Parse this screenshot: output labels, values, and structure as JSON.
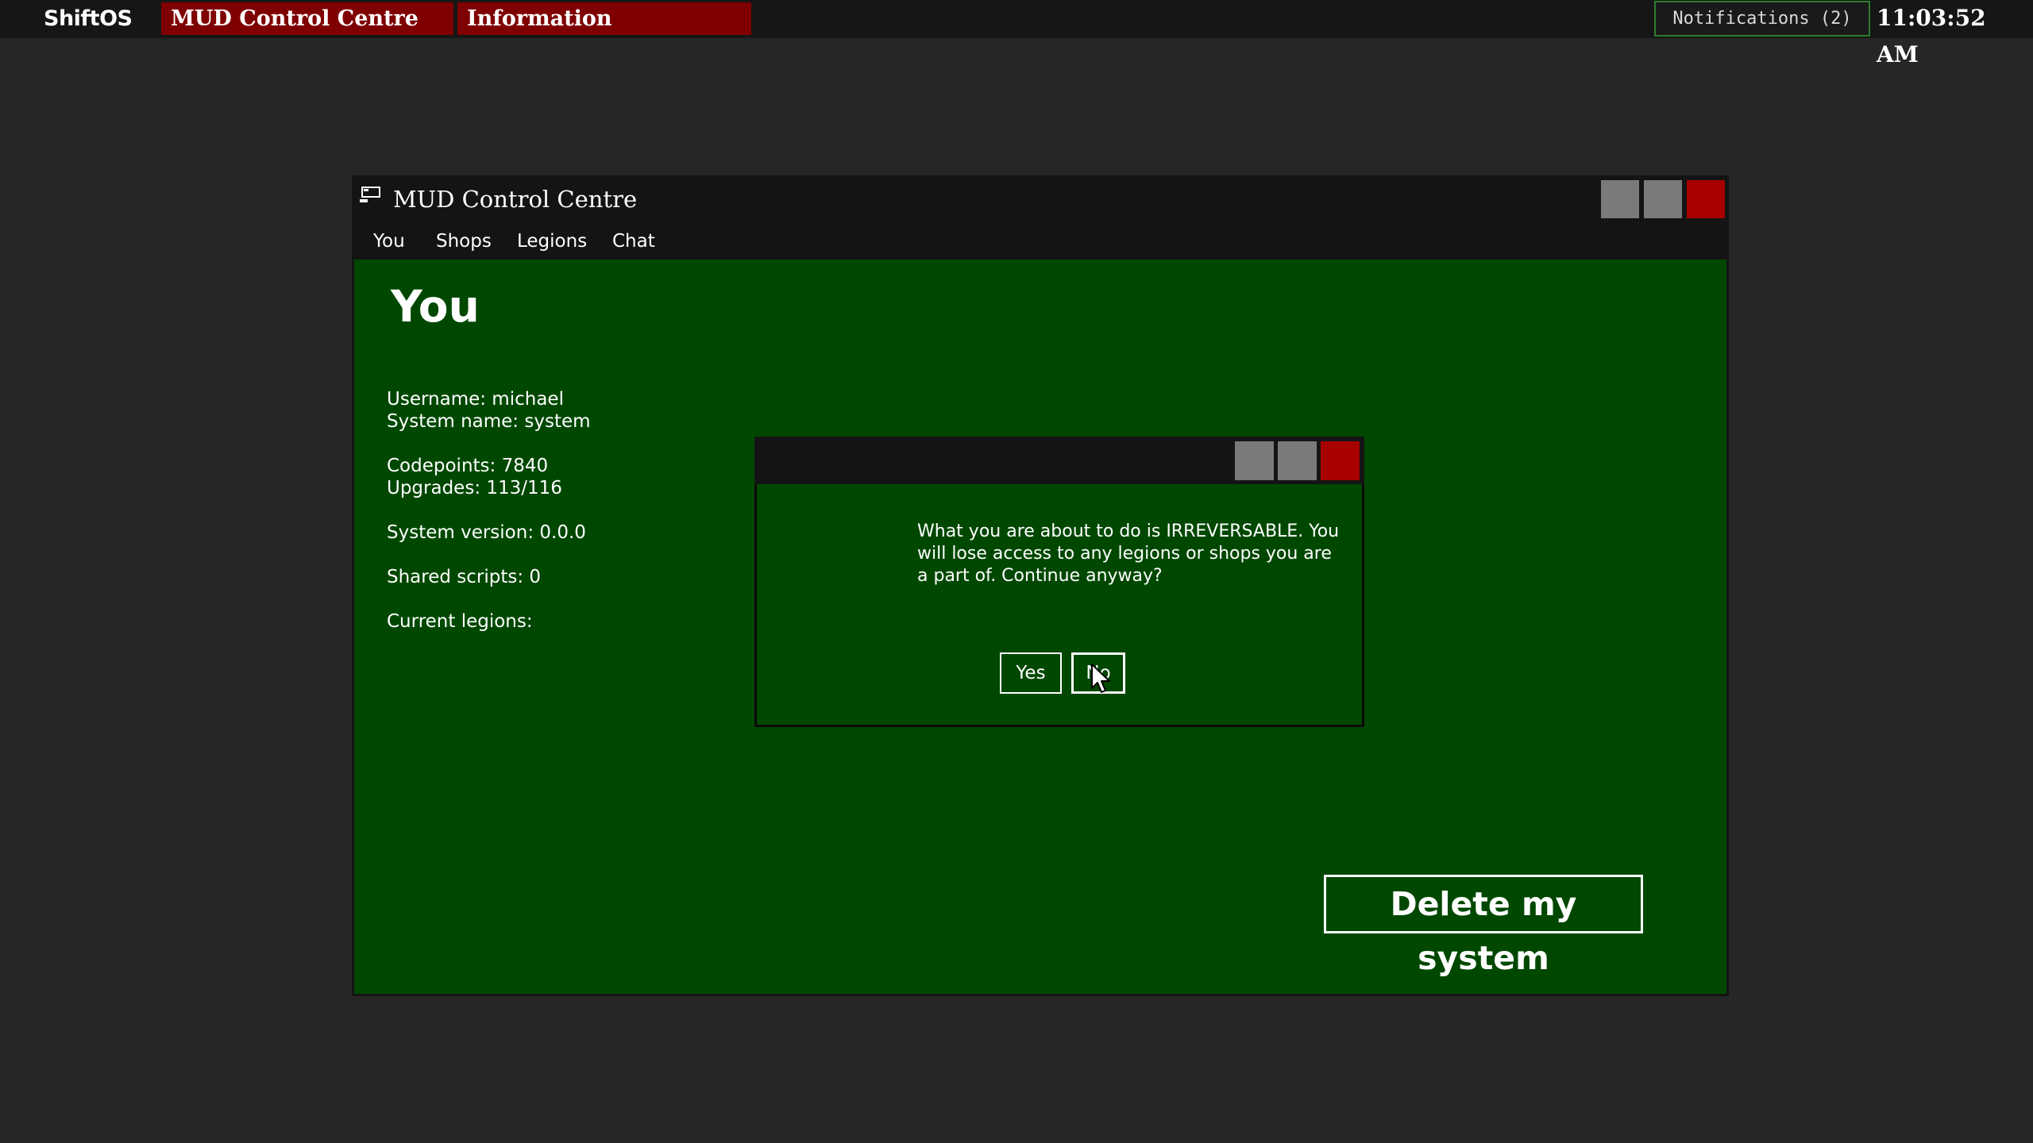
{
  "panel": {
    "start_label": "ShiftOS",
    "tasks": [
      {
        "label": "MUD Control Centre"
      },
      {
        "label": "Information"
      }
    ],
    "notifications_label": "Notifications (2)",
    "clock": "11:03:52 AM"
  },
  "window": {
    "title": "MUD Control Centre",
    "icon": "terminal-window-icon",
    "menu": [
      "You",
      "Shops",
      "Legions",
      "Chat"
    ],
    "heading": "You",
    "info": {
      "username": "Username: michael",
      "system_name": "System name: system",
      "codepoints": "Codepoints: 7840",
      "upgrades": "Upgrades: 113/116",
      "system_version": "System version: 0.0.0",
      "shared_scripts": "Shared scripts: 0",
      "current_legions": "Current legions:"
    },
    "delete_button": "Delete my system"
  },
  "dialog": {
    "title": "",
    "message": "What you are about to do is IRREVERSABLE. You will lose access to any legions or shops you are a part of. Continue anyway?",
    "yes_label": "Yes",
    "no_label": "No"
  },
  "colors": {
    "desktop": "#262626",
    "panel": "#161616",
    "task_button": "#7f0000",
    "window_chrome": "#141414",
    "content_green": "#004800",
    "close_red": "#a80000",
    "button_gray": "#7a7a7a",
    "notification_border": "#2e7d2e"
  }
}
